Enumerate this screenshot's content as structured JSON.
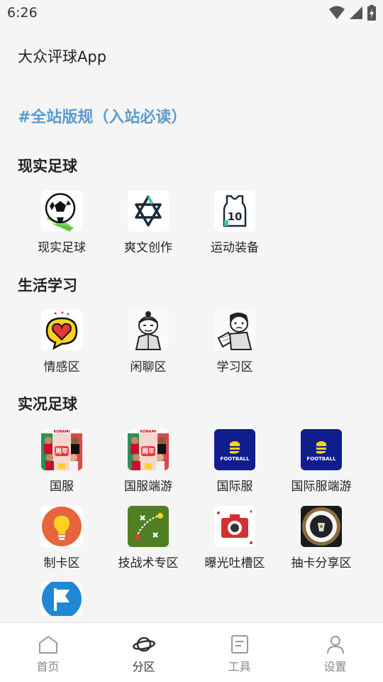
{
  "status_bar": {
    "time": "6:26"
  },
  "app": {
    "title": "大众评球App"
  },
  "rules_link": "#全站版规（入站必读）",
  "sections": [
    {
      "title": "现实足球",
      "items": [
        {
          "label": "现实足球",
          "icon": "soccer-ball-icon"
        },
        {
          "label": "爽文创作",
          "icon": "star-of-david-icon"
        },
        {
          "label": "运动装备",
          "icon": "jersey-icon"
        }
      ]
    },
    {
      "title": "生活学习",
      "items": [
        {
          "label": "情感区",
          "icon": "heart-speech-icon"
        },
        {
          "label": "闲聊区",
          "icon": "meme-face-icon"
        },
        {
          "label": "学习区",
          "icon": "study-meme-icon"
        }
      ]
    },
    {
      "title": "实况足球",
      "items": [
        {
          "label": "国服",
          "icon": "konami-players-icon"
        },
        {
          "label": "国服端游",
          "icon": "konami-players-icon"
        },
        {
          "label": "国际服",
          "icon": "efootball-icon"
        },
        {
          "label": "国际服端游",
          "icon": "efootball-icon"
        },
        {
          "label": "制卡区",
          "icon": "lightbulb-icon"
        },
        {
          "label": "技战术专区",
          "icon": "tactics-board-icon"
        },
        {
          "label": "曝光吐槽区",
          "icon": "camera-icon"
        },
        {
          "label": "抽卡分享区",
          "icon": "card-draw-icon"
        },
        {
          "label": "",
          "icon": "flag-icon"
        }
      ]
    }
  ],
  "badge_text": {
    "konami": "KONAMI",
    "anniversary": "周年",
    "efootball": "FOOTBALL",
    "jersey_number": "10"
  },
  "bottom_nav": [
    {
      "label": "首页",
      "icon": "home-icon",
      "active": false
    },
    {
      "label": "分区",
      "icon": "planet-icon",
      "active": true
    },
    {
      "label": "工具",
      "icon": "tools-doc-icon",
      "active": false
    },
    {
      "label": "设置",
      "icon": "user-icon",
      "active": false
    }
  ],
  "colors": {
    "accent": "#5a9bd0",
    "background": "#f5f5f5",
    "nav_active": "#333333",
    "nav_inactive": "#888888"
  }
}
